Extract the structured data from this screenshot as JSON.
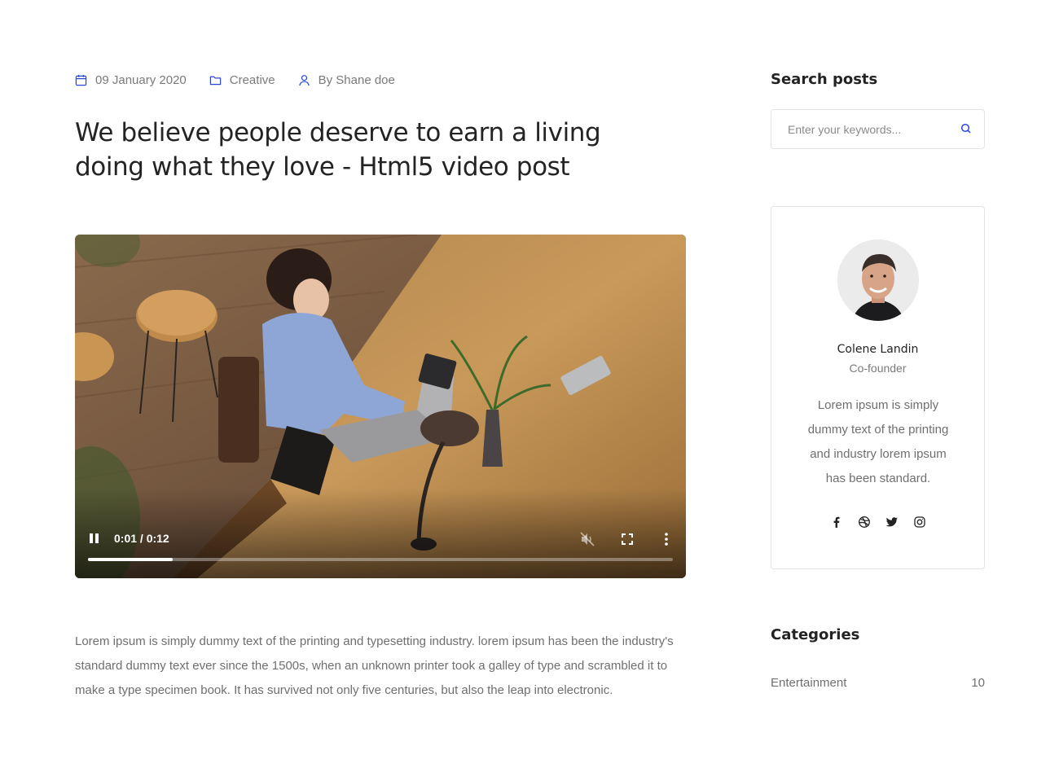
{
  "post": {
    "meta": {
      "date": "09 January 2020",
      "category": "Creative",
      "author": "By Shane doe"
    },
    "title": "We believe people deserve to earn a living doing what they love - Html5 video post",
    "video": {
      "time_display": "0:01 / 0:12",
      "progress": 0.145,
      "state": "playing",
      "muted": true
    },
    "body": "Lorem ipsum is simply dummy text of the printing and typesetting industry. lorem ipsum has been the industry's standard dummy text ever since the 1500s, when an unknown printer took a galley of type and scrambled it to make a type specimen book. It has survived not only five centuries, but also the leap into electronic."
  },
  "sidebar": {
    "search": {
      "title": "Search posts",
      "placeholder": "Enter your keywords...",
      "icon": "search-icon"
    },
    "author": {
      "name": "Colene Landin",
      "role": "Co-founder",
      "bio": "Lorem ipsum is simply dummy text of the printing and industry lorem ipsum has been standard.",
      "social": [
        "facebook-icon",
        "dribbble-icon",
        "twitter-icon",
        "instagram-icon"
      ]
    },
    "categories": {
      "title": "Categories",
      "items": [
        {
          "label": "Entertainment",
          "count": "10"
        }
      ]
    }
  },
  "colors": {
    "accent": "#2946d9",
    "heading": "#232323",
    "text": "#6f6f6f",
    "border": "#e4e4e4"
  }
}
